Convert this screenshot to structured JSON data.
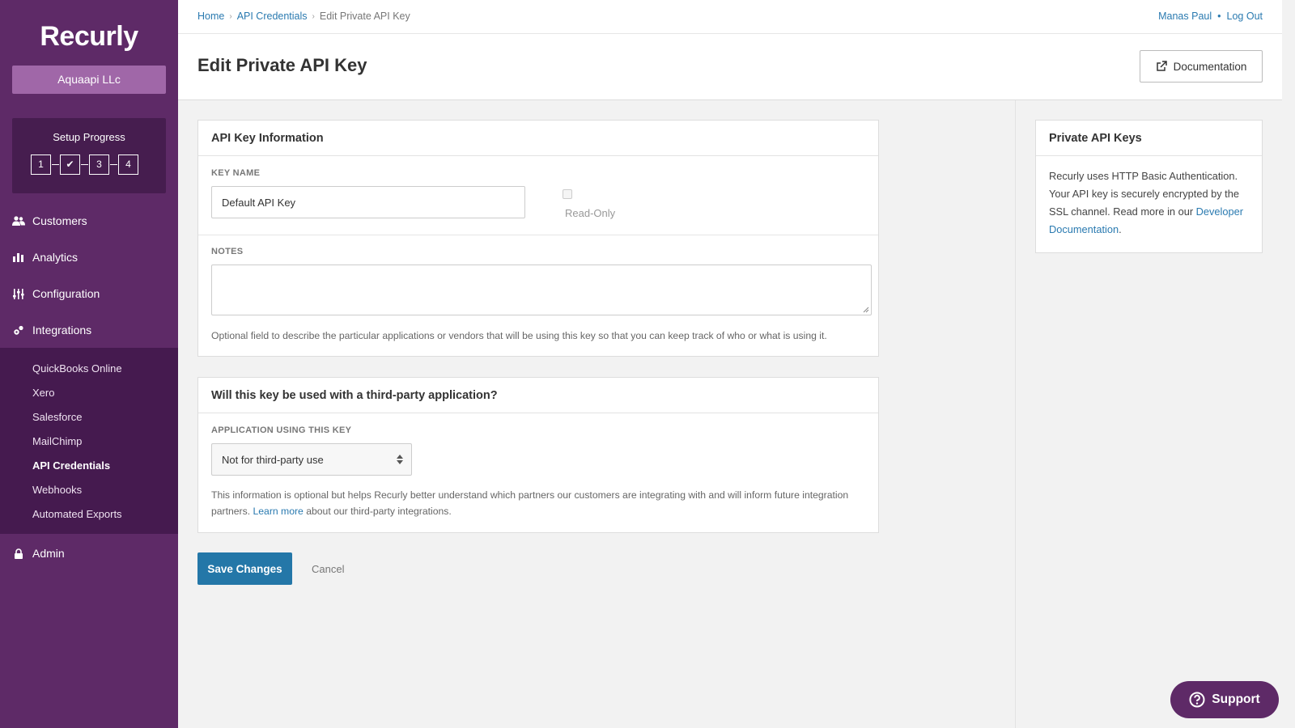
{
  "sidebar": {
    "logo": "Recurly",
    "account": "Aquaapi LLc",
    "setup": {
      "title": "Setup Progress",
      "steps": [
        "1",
        "✔",
        "3",
        "4"
      ]
    },
    "nav": [
      {
        "label": "Customers",
        "icon": "customers-icon"
      },
      {
        "label": "Analytics",
        "icon": "analytics-icon"
      },
      {
        "label": "Configuration",
        "icon": "configuration-icon"
      },
      {
        "label": "Integrations",
        "icon": "integrations-icon"
      }
    ],
    "sub_items": [
      "QuickBooks Online",
      "Xero",
      "Salesforce",
      "MailChimp",
      "API Credentials",
      "Webhooks",
      "Automated Exports"
    ],
    "admin": "Admin"
  },
  "topbar": {
    "breadcrumbs": [
      "Home",
      "API Credentials",
      "Edit Private API Key"
    ],
    "user": "Manas Paul",
    "logout": "Log Out"
  },
  "header": {
    "title": "Edit Private API Key",
    "doc_button": "Documentation"
  },
  "api_key_panel": {
    "title": "API Key Information",
    "key_name_label": "KEY NAME",
    "key_name_value": "Default API Key",
    "read_only_label": "Read-Only",
    "notes_label": "NOTES",
    "notes_value": "",
    "notes_help": "Optional field to describe the particular applications or vendors that will be using this key so that you can keep track of who or what is using it."
  },
  "third_party_panel": {
    "title": "Will this key be used with a third-party application?",
    "app_label": "APPLICATION USING THIS KEY",
    "app_value": "Not for third-party use",
    "help_text_1": "This information is optional but helps Recurly better understand which partners our customers are integrating with and will inform future integration partners.",
    "learn_more": "Learn more",
    "help_text_2": "about our third-party integrations."
  },
  "actions": {
    "save": "Save Changes",
    "cancel": "Cancel"
  },
  "side_panel": {
    "title": "Private API Keys",
    "text": "Recurly uses HTTP Basic Authentication. Your API key is securely encrypted by the SSL channel. Read more in our",
    "link": "Developer Documentation",
    "end": "."
  },
  "support": "Support",
  "colors": {
    "sidebar": "#5e2a67",
    "subnav": "#451a4f",
    "accent_button": "#a067a8",
    "primary": "#2477a8",
    "link": "#2a7ab0"
  }
}
